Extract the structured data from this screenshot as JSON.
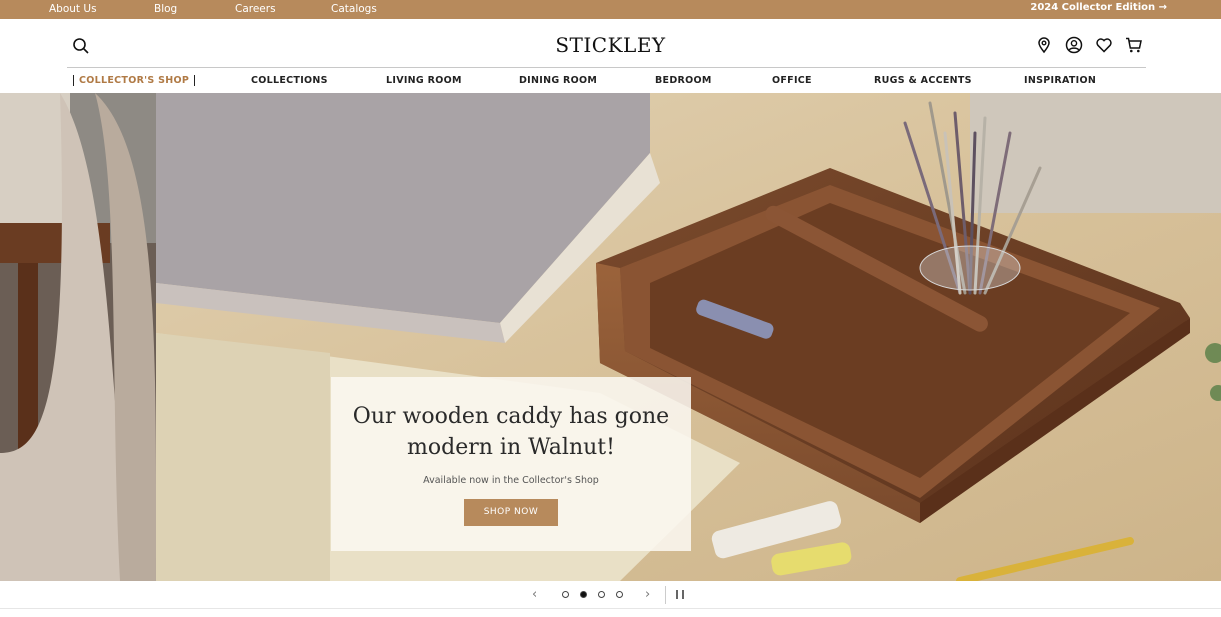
{
  "topbar": {
    "links": [
      "About Us",
      "Blog",
      "Careers",
      "Catalogs"
    ],
    "promo": "2024 Collector Edition →"
  },
  "header": {
    "logo": "STICKLEY",
    "icons": [
      "search-icon",
      "location-pin-icon",
      "account-icon",
      "heart-icon",
      "cart-icon"
    ]
  },
  "nav": {
    "items": [
      "Collector's Shop",
      "Collections",
      "Living Room",
      "Dining Room",
      "Bedroom",
      "Office",
      "Rugs & Accents",
      "Inspiration"
    ]
  },
  "hero": {
    "headline": "Our wooden caddy has gone modern in Walnut!",
    "subtext": "Available now in the Collector's Shop",
    "cta": "Shop Now"
  },
  "carousel": {
    "slide_count": 4,
    "active_slide": 2,
    "prev_icon": "chevron-left-icon",
    "next_icon": "chevron-right-icon",
    "pause_icon": "pause-icon"
  },
  "colors": {
    "accent": "#b78a5c",
    "collectors_link": "#b07a45"
  }
}
